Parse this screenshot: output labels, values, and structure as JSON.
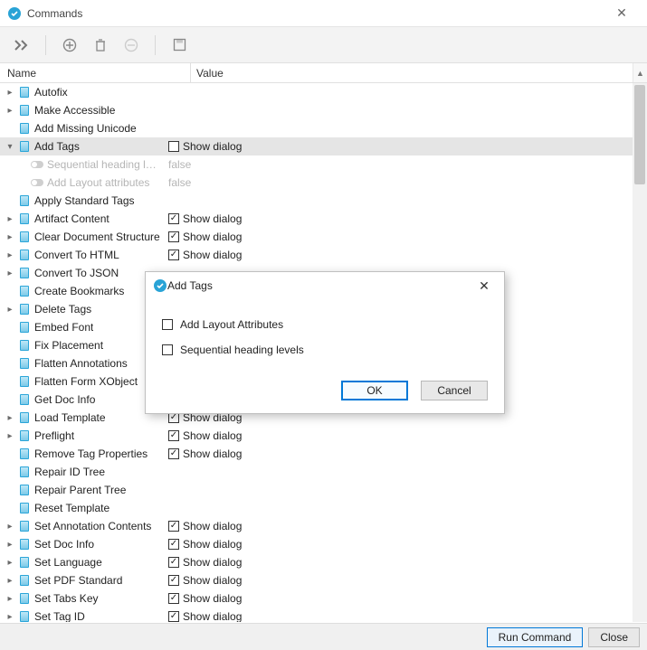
{
  "window": {
    "title": "Commands"
  },
  "columns": {
    "name": "Name",
    "value": "Value"
  },
  "rows": [
    {
      "caret": ">",
      "icon": "doc",
      "label": "Autofix"
    },
    {
      "caret": ">",
      "icon": "doc",
      "label": "Make Accessible"
    },
    {
      "caret": "",
      "icon": "doc",
      "label": "Add Missing Unicode"
    },
    {
      "caret": "v",
      "icon": "doc",
      "label": "Add Tags",
      "selected": true,
      "value_cb": "unchecked",
      "value_text": "Show dialog"
    },
    {
      "caret": "",
      "icon": "toggle",
      "indent": 1,
      "dim": true,
      "label": "Sequential heading l…",
      "value_text": "false",
      "value_dim": true
    },
    {
      "caret": "",
      "icon": "toggle",
      "indent": 1,
      "dim": true,
      "label": "Add Layout attributes",
      "value_text": "false",
      "value_dim": true
    },
    {
      "caret": "",
      "icon": "doc",
      "label": "Apply Standard Tags"
    },
    {
      "caret": ">",
      "icon": "doc",
      "label": "Artifact Content",
      "value_cb": "checked",
      "value_text": "Show dialog"
    },
    {
      "caret": ">",
      "icon": "doc",
      "label": "Clear Document Structure",
      "value_cb": "checked",
      "value_text": "Show dialog"
    },
    {
      "caret": ">",
      "icon": "doc",
      "label": "Convert To HTML",
      "value_cb": "checked",
      "value_text": "Show dialog"
    },
    {
      "caret": ">",
      "icon": "doc",
      "label": "Convert To JSON"
    },
    {
      "caret": "",
      "icon": "doc",
      "label": "Create Bookmarks"
    },
    {
      "caret": ">",
      "icon": "doc",
      "label": "Delete Tags"
    },
    {
      "caret": "",
      "icon": "doc",
      "label": "Embed Font"
    },
    {
      "caret": "",
      "icon": "doc",
      "label": "Fix Placement"
    },
    {
      "caret": "",
      "icon": "doc",
      "label": "Flatten Annotations"
    },
    {
      "caret": "",
      "icon": "doc",
      "label": "Flatten Form XObject"
    },
    {
      "caret": "",
      "icon": "doc",
      "label": "Get Doc Info"
    },
    {
      "caret": ">",
      "icon": "doc",
      "label": "Load Template",
      "value_cb": "checked",
      "value_text": "Show dialog"
    },
    {
      "caret": ">",
      "icon": "doc",
      "label": "Preflight",
      "value_cb": "checked",
      "value_text": "Show dialog"
    },
    {
      "caret": "",
      "icon": "doc",
      "label": "Remove Tag Properties",
      "value_cb": "checked",
      "value_text": "Show dialog"
    },
    {
      "caret": "",
      "icon": "doc",
      "label": "Repair ID Tree"
    },
    {
      "caret": "",
      "icon": "doc",
      "label": "Repair Parent Tree"
    },
    {
      "caret": "",
      "icon": "doc",
      "label": "Reset Template"
    },
    {
      "caret": ">",
      "icon": "doc",
      "label": "Set Annotation Contents",
      "value_cb": "checked",
      "value_text": "Show dialog"
    },
    {
      "caret": ">",
      "icon": "doc",
      "label": "Set Doc Info",
      "value_cb": "checked",
      "value_text": "Show dialog"
    },
    {
      "caret": ">",
      "icon": "doc",
      "label": "Set Language",
      "value_cb": "checked",
      "value_text": "Show dialog"
    },
    {
      "caret": ">",
      "icon": "doc",
      "label": "Set PDF Standard",
      "value_cb": "checked",
      "value_text": "Show dialog"
    },
    {
      "caret": ">",
      "icon": "doc",
      "label": "Set Tabs Key",
      "value_cb": "checked",
      "value_text": "Show dialog"
    },
    {
      "caret": ">",
      "icon": "doc",
      "label": "Set Tag ID",
      "value_cb": "checked",
      "value_text": "Show dialog"
    }
  ],
  "footer": {
    "run": "Run Command",
    "close": "Close"
  },
  "dialog": {
    "title": "Add Tags",
    "opt1": "Add Layout Attributes",
    "opt2": "Sequential heading levels",
    "ok": "OK",
    "cancel": "Cancel"
  }
}
